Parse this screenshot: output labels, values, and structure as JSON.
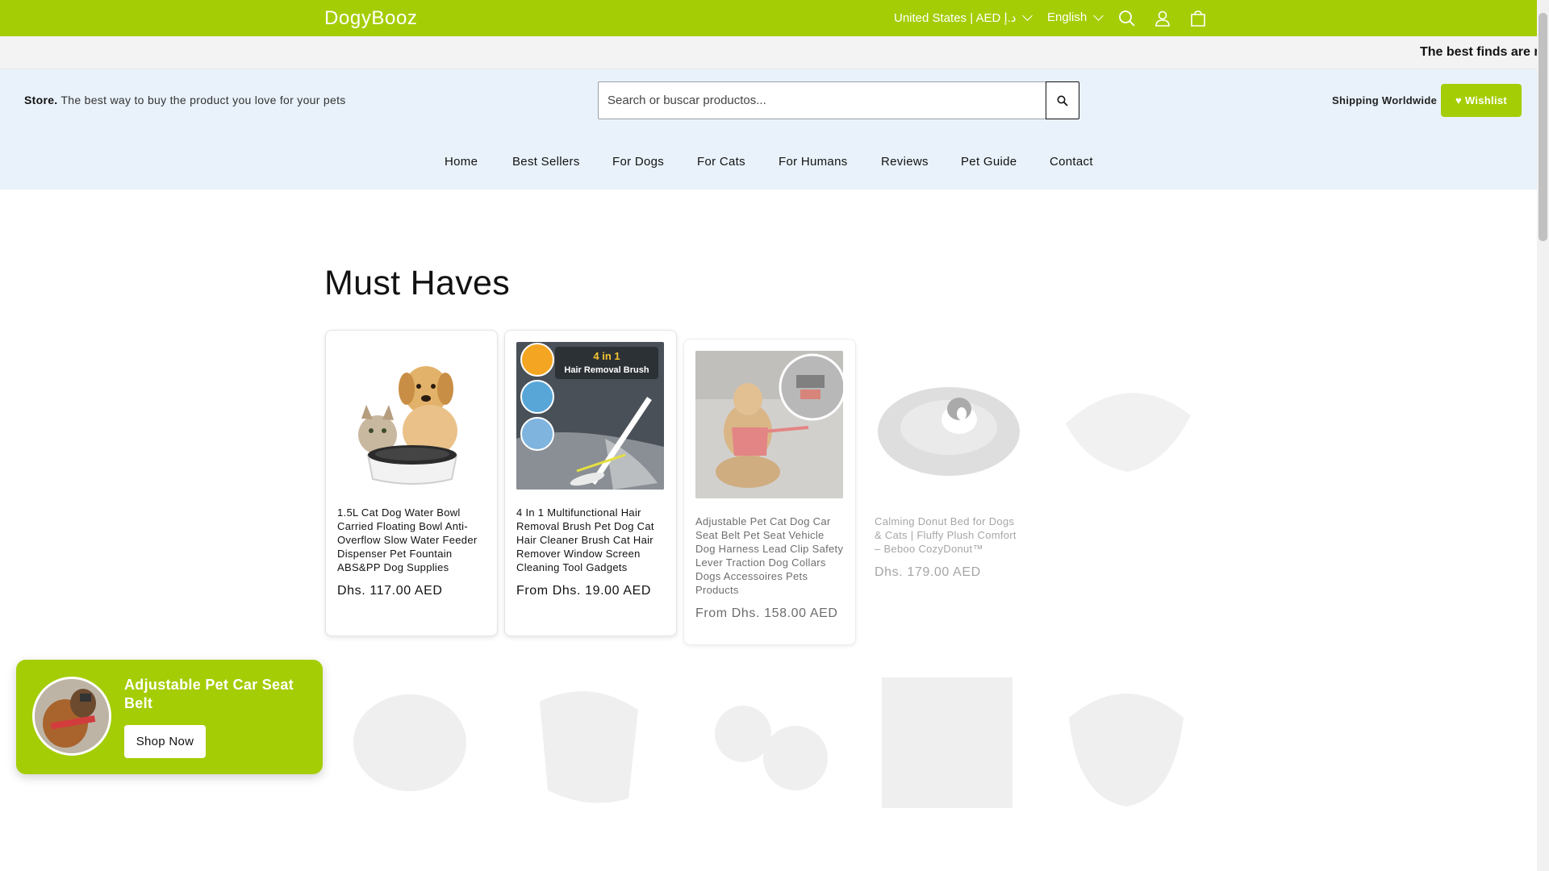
{
  "header_top": {
    "logo": "DogyBooz",
    "country": "United States | AED د.إ",
    "language": "English",
    "icons": [
      "search-icon",
      "account-icon",
      "cart-icon"
    ]
  },
  "announcement": "The best finds are r",
  "header": {
    "tagline_bold": "Store.",
    "tagline_rest": "The best way to buy the product you love for your pets",
    "search_placeholder": "Search or buscar productos...",
    "shipping": "Shipping Worldwide",
    "wishlist": "♥ Wishlist"
  },
  "nav": [
    "Home",
    "Best Sellers",
    "For Dogs",
    "For Cats",
    "For Humans",
    "Reviews",
    "Pet Guide",
    "Contact"
  ],
  "section": {
    "title": "Must Haves",
    "products": [
      {
        "title": "1.5L Cat Dog Water Bowl Carried Floating Bowl Anti-Overflow Slow Water Feeder Dispenser Pet Fountain ABS&PP Dog Supplies",
        "price": "Dhs. 117.00 AED"
      },
      {
        "title": "4 In 1 Multifunctional Hair Removal Brush Pet Dog Cat Hair Cleaner Brush Cat Hair Remover Window Screen Cleaning Tool Gadgets",
        "price": "From Dhs. 19.00 AED",
        "image_label": "4 in 1 Hair Removal Brush"
      },
      {
        "title": "Adjustable Pet Cat Dog Car Seat Belt Pet Seat Vehicle Dog Harness Lead Clip Safety Lever Traction Dog Collars Dogs Accessoires Pets Products",
        "price": "From Dhs. 158.00 AED"
      },
      {
        "title": "Calming Donut Bed for Dogs & Cats | Fluffy Plush Comfort – Beboo CozyDonut™",
        "price": "Dhs. 179.00 AED"
      },
      {
        "title": "",
        "price": ""
      }
    ]
  },
  "popup": {
    "title": "Adjustable Pet Car Seat Belt",
    "button": "Shop Now"
  },
  "colors": {
    "brand_green": "#a5cd05",
    "header_bg": "#e9f2fa",
    "announce_bg": "#f3f3f3"
  }
}
